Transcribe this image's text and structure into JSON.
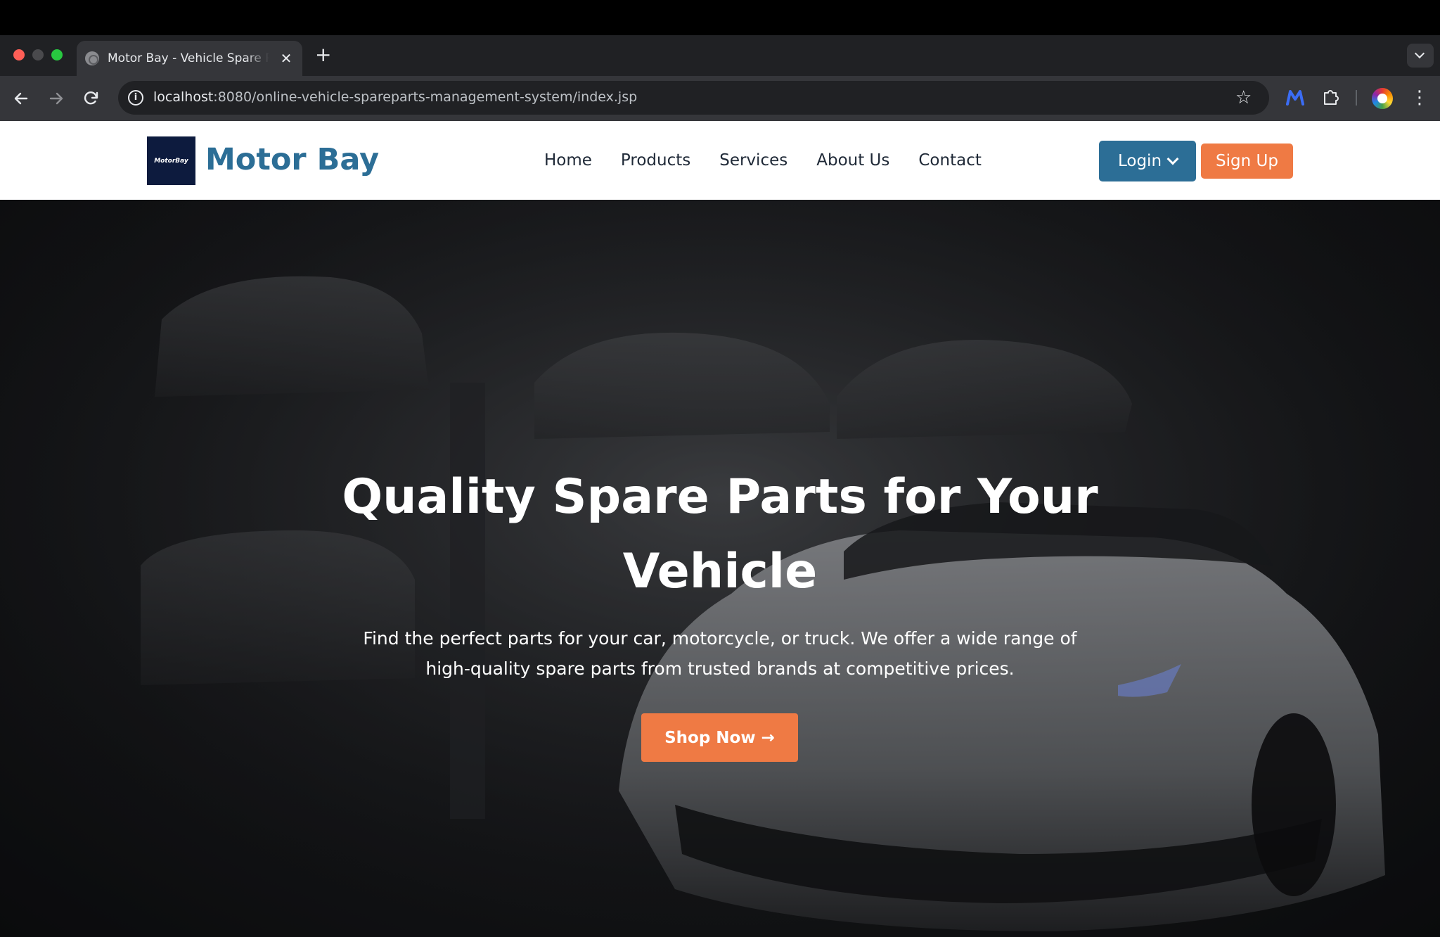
{
  "browser": {
    "tab_title": "Motor Bay - Vehicle Spare Parts",
    "tab_close": "✕",
    "new_tab": "+",
    "url_host": "localhost",
    "url_rest": ":8080/online-vehicle-spareparts-management-system/index.jsp",
    "icons": {
      "back": "arrow-left-icon",
      "forward": "arrow-right-icon",
      "reload": "reload-icon",
      "site_info": "info-icon",
      "bookmark": "star-icon",
      "extension": "puzzle-icon",
      "menu": "kebab-icon"
    }
  },
  "site": {
    "logo_text": "MotorBay",
    "brand": "Motor Bay",
    "brand_color": "#2c6e96",
    "accent_color": "#ef7a44",
    "nav": [
      {
        "label": "Home"
      },
      {
        "label": "Products"
      },
      {
        "label": "Services"
      },
      {
        "label": "About Us"
      },
      {
        "label": "Contact"
      }
    ],
    "login_label": "Login",
    "signup_label": "Sign Up"
  },
  "hero": {
    "title": "Quality Spare Parts for Your Vehicle",
    "subtitle": "Find the perfect parts for your car, motorcycle, or truck. We offer a wide range of high-quality spare parts from trusted brands at competitive prices.",
    "cta_label": "Shop Now",
    "cta_arrow": "→"
  }
}
